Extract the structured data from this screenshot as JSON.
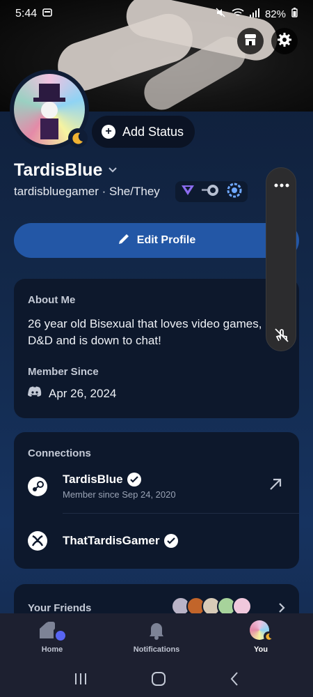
{
  "status_bar": {
    "time": "5:44",
    "battery": "82%"
  },
  "profile": {
    "add_status_label": "Add Status",
    "display_name": "TardisBlue",
    "handle": "tardisbluegamer · She/They",
    "edit_profile_label": "Edit Profile"
  },
  "about": {
    "label": "About Me",
    "bio": "26 year old Bisexual that loves video games, D&D and is down to chat!",
    "member_since_label": "Member Since",
    "member_since_date": "Apr 26, 2024"
  },
  "connections": {
    "label": "Connections",
    "items": [
      {
        "name": "TardisBlue",
        "subtitle": "Member since Sep 24, 2020",
        "service_icon": "steam-icon"
      },
      {
        "name": "ThatTardisGamer",
        "service_icon": "xbox-icon"
      }
    ]
  },
  "friends": {
    "label": "Your Friends"
  },
  "nav": {
    "home": "Home",
    "notifications": "Notifications",
    "you": "You"
  },
  "colors": {
    "accent": "#2357a6",
    "background": "#13294b",
    "card": "#0d182c",
    "nitro_badge": "#8c6cf0"
  }
}
